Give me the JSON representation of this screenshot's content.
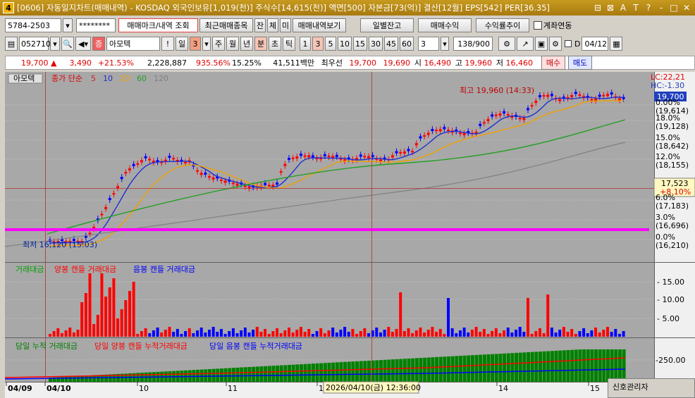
{
  "window": {
    "app_number": "4",
    "title": "[0606] 자동일지차트(매매내역) - KOSDAQ 외국인보유[1,019(천)] 주식수[14,615(천)] 액면[500] 자본금[73(억)] 결산[12월] EPS[542] PER[36.35]"
  },
  "toolbar1": {
    "account": "5784-2503",
    "password": "********",
    "btn_trade_mark": "매매마크/내역 조회",
    "btn_recent_items": "최근매매종목",
    "btn_jan": "잔",
    "btn_che": "체",
    "btn_mi": "미",
    "btn_trade_history": "매매내역보기",
    "btn_daily_balance": "일별잔고",
    "btn_trade_profit": "매매수익",
    "btn_return_trend": "수익률추이",
    "chk_account_link": "계좌연동"
  },
  "toolbar2": {
    "code": "052710",
    "stock_name": "아모텍",
    "period_num": "3",
    "periods": [
      "일",
      "주",
      "월",
      "년",
      "분",
      "초",
      "틱"
    ],
    "period_active": "분",
    "minutes": [
      "1",
      "3",
      "5",
      "10",
      "15",
      "30",
      "45",
      "60"
    ],
    "minute_active": "3",
    "count_sel": "3",
    "page": "138/900",
    "date": "04/12"
  },
  "quote": {
    "price": "19,700",
    "change": "3,490",
    "change_pct": "+21.53%",
    "volume": "2,228,887",
    "vol_ratio": "935.56%",
    "turnover": "15.25%",
    "amount": "41,511백만",
    "priority_label": "최우선",
    "ask": "19,700",
    "bid": "19,690",
    "open_label": "시",
    "open": "16,490",
    "high_label": "고",
    "high": "19,960",
    "low_label": "저",
    "low": "16,460",
    "buy_btn": "매수",
    "sell_btn": "매도"
  },
  "chart_data": {
    "type": "candlestick",
    "stock_label": "아모텍",
    "legend": "종가 단순",
    "ma_periods": [
      "5",
      "10",
      "20",
      "60",
      "120"
    ],
    "ma_colors": [
      "#d02020",
      "#2030d0",
      "#f0a000",
      "#20a020",
      "#808080"
    ],
    "lc_label": "LC:22,21",
    "hc_label": "HC:-1.30",
    "current_price_tag": "19,700",
    "cross_tag_price": "17,523",
    "cross_tag_pct": "+8.10%",
    "high_annotation": "최고 19,960 (14:33)",
    "low_annotation": "최저 16,120 (15:03)",
    "y_axis_pct": [
      "0.00%",
      "18.0%",
      "15.0%",
      "12.0%",
      "6.0%",
      "3.0%",
      "0.0%"
    ],
    "y_axis_price": [
      "(19,614)",
      "(19,128)",
      "(18,642)",
      "(18,155)",
      "(17,183)",
      "(16,696)",
      "(16,210)"
    ],
    "volume_panel": {
      "title": "거래대금",
      "series": [
        "양봉 캔들 거래대금",
        "음봉 캔들 거래대금"
      ],
      "series_colors": [
        "#ff0000",
        "#0000ff"
      ],
      "y_ticks": [
        "15.00",
        "10.00",
        "5.00"
      ]
    },
    "cum_panel": {
      "series": [
        "당일 누적 거래대금",
        "당일 양봉 캔들 누적거래대금",
        "당일 음봉 캔들 누적거래대금"
      ],
      "series_colors": [
        "#008000",
        "#ff0000",
        "#0000ff"
      ],
      "y_ticks": [
        "250.00"
      ]
    },
    "x_labels": [
      "04/09",
      "04/10",
      "10",
      "11",
      "12",
      "14",
      "15"
    ],
    "cursor_time": "2026/04/10(금) 12:36:00"
  },
  "side_panel": {
    "title": "신호관리자"
  }
}
